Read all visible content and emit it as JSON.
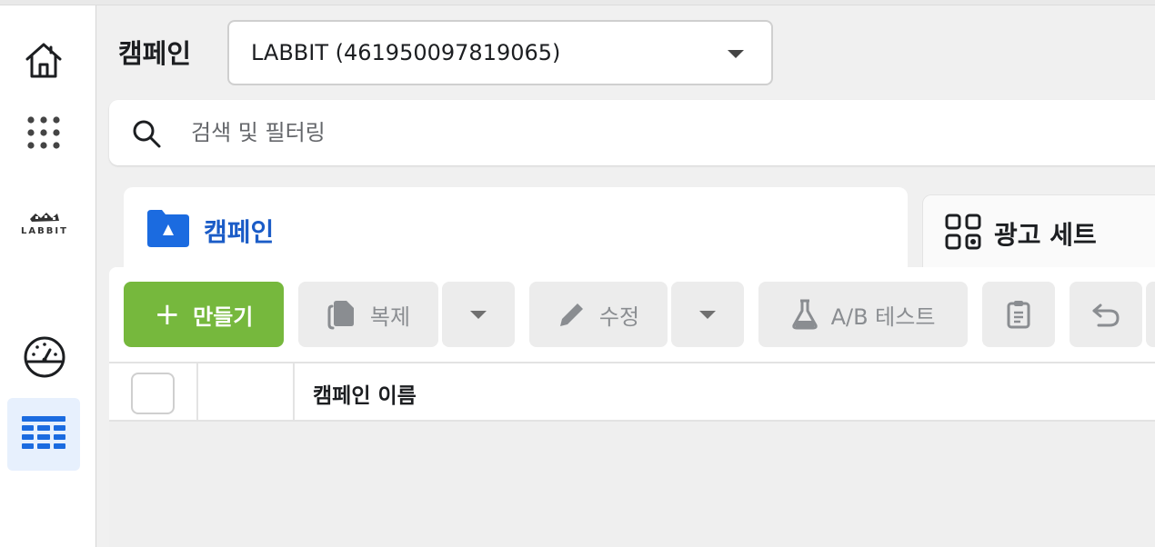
{
  "header": {
    "page_title": "캠페인",
    "account_selector_value": "LABBIT (461950097819065)"
  },
  "search": {
    "placeholder": "검색 및 필터링"
  },
  "sidebar": {
    "items": [
      {
        "icon": "home-icon"
      },
      {
        "icon": "apps-grid-icon"
      },
      {
        "icon": "labbit-logo"
      },
      {
        "icon": "gauge-icon"
      },
      {
        "icon": "table-icon",
        "active": true
      }
    ],
    "logo_text": "LABBIT"
  },
  "tabs": [
    {
      "label": "캠페인",
      "icon": "folder-icon",
      "active": true
    },
    {
      "label": "광고 세트",
      "icon": "grid-icon",
      "active": false
    }
  ],
  "toolbar": {
    "create_label": "만들기",
    "duplicate_label": "복제",
    "edit_label": "수정",
    "ab_test_label": "A/B 테스트"
  },
  "table": {
    "columns": [
      "캠페인 이름"
    ]
  },
  "colors": {
    "accent_blue": "#1b5cc7",
    "create_green": "#76b83d",
    "active_sidebar_bg": "#e7f0fd"
  }
}
